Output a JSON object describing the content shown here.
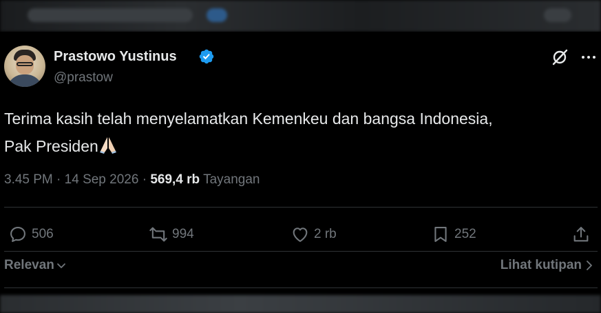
{
  "author": {
    "name": "Prastowo Yustinus",
    "handle": "@prastow",
    "verified": true,
    "verified_color": "#1d9bf0"
  },
  "header_icons": [
    "grok-icon",
    "more-icon"
  ],
  "tweet": {
    "text_line1": "Terima kasih telah menyelamatkan Kemenkeu dan bangsa Indonesia,",
    "text_line2": "Pak Presiden",
    "emoji": "folded-hands-icon"
  },
  "meta": {
    "time": "3.45 PM",
    "separator": "·",
    "date": "14 Sep 2026",
    "views_count": "569,4 rb",
    "views_label": "Tayangan"
  },
  "actions": {
    "replies": "506",
    "reposts": "994",
    "likes": "2 rb",
    "bookmarks": "252"
  },
  "footer": {
    "sort_label": "Relevan",
    "quotes_link": "Lihat kutipan"
  },
  "colors": {
    "background": "#000000",
    "text": "#e7e9ea",
    "muted": "#71767b",
    "divider": "#2f3336",
    "accent": "#1d9bf0"
  }
}
